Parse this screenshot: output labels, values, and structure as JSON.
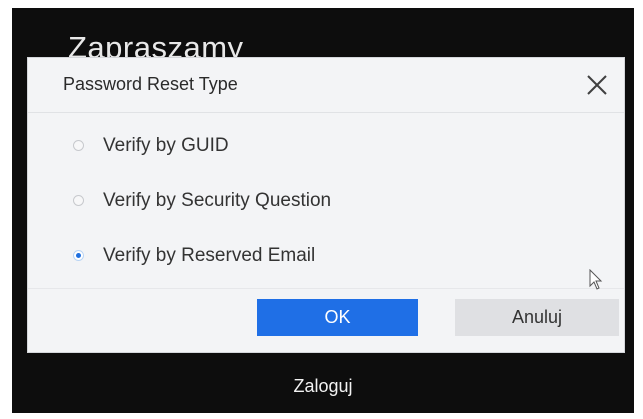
{
  "background": {
    "welcome_text": "Zapraszamy",
    "login_label": "Zaloguj"
  },
  "dialog": {
    "title": "Password Reset Type",
    "close_icon": "close-icon",
    "options": [
      {
        "label": "Verify by GUID",
        "selected": false
      },
      {
        "label": "Verify by Security Question",
        "selected": false
      },
      {
        "label": "Verify by Reserved Email",
        "selected": true
      }
    ],
    "ok_label": "OK",
    "cancel_label": "Anuluj"
  },
  "colors": {
    "accent": "#1f6fe6",
    "screen_background": "#0d0d0d",
    "dialog_background": "#f3f4f6",
    "cancel_button": "#dfe0e3"
  },
  "icons": {
    "close": "close-icon",
    "pointer": "mouse-pointer-icon"
  }
}
